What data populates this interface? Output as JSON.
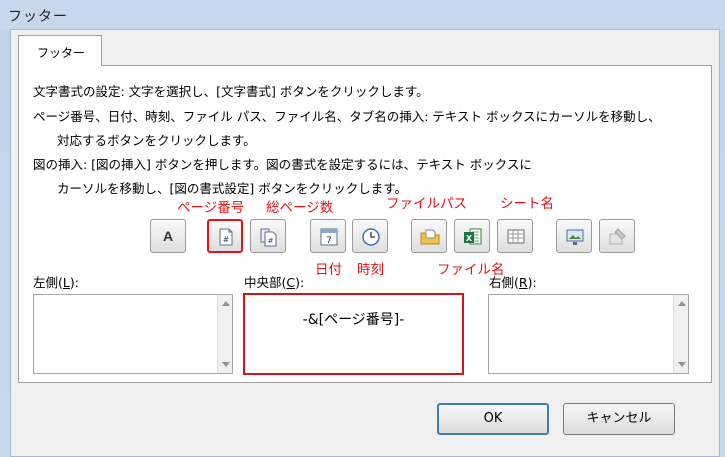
{
  "window": {
    "title": "フッター"
  },
  "tab": {
    "label": "フッター"
  },
  "instructions": {
    "line1": "文字書式の設定: 文字を選択し、[文字書式] ボタンをクリックします。",
    "line2": "ページ番号、日付、時刻、ファイル パス、ファイル名、タブ名の挿入: テキスト ボックスにカーソルを移動し、",
    "line3": "対応するボタンをクリックします。",
    "line4": "図の挿入: [図の挿入] ボタンを押します。図の書式を設定するには、テキスト ボックスに",
    "line5": "カーソルを移動し、[図の書式設定] ボタンをクリックします。"
  },
  "toolbar": {
    "format_text_glyph": "A",
    "icons": [
      "format-text-icon",
      "page-number-icon",
      "total-pages-icon",
      "date-icon",
      "time-icon",
      "file-path-icon",
      "file-name-icon",
      "sheet-name-icon",
      "insert-picture-icon",
      "format-picture-icon"
    ]
  },
  "callouts": {
    "page_number": "ページ番号",
    "total_pages": "総ページ数",
    "date": "日付",
    "time": "時刻",
    "file_path": "ファイルパス",
    "file_name": "ファイル名",
    "sheet_name": "シート名"
  },
  "sections": {
    "left": {
      "label": "左側(",
      "key": "L",
      "suffix": "):",
      "value": ""
    },
    "center": {
      "label": "中央部(",
      "key": "C",
      "suffix": "):",
      "value": "-&[ページ番号]-"
    },
    "right": {
      "label": "右側(",
      "key": "R",
      "suffix": "):",
      "value": ""
    }
  },
  "buttons": {
    "ok": "OK",
    "cancel": "キャンセル"
  },
  "colors": {
    "highlight": "#e0151b",
    "title_bar": "#c8d8ec",
    "ok_border": "#3c7fb1"
  }
}
